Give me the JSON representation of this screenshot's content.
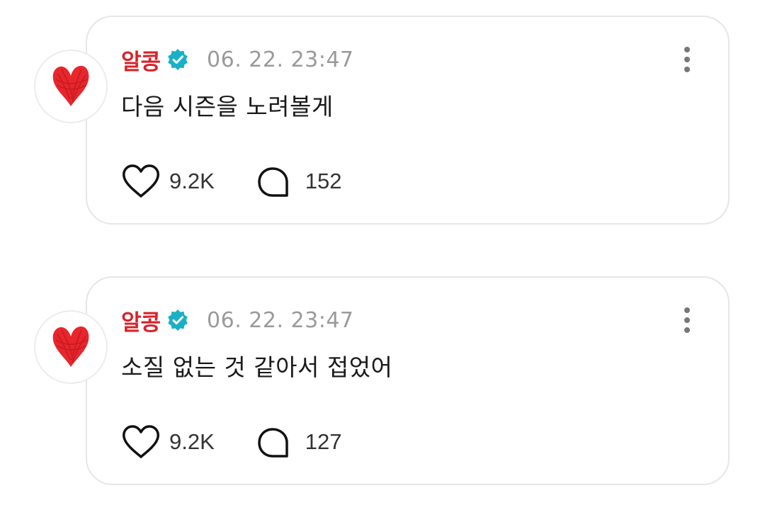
{
  "posts": [
    {
      "author": "알콩",
      "timestamp": "06. 22. 23:47",
      "text": "다음 시즌을 노려볼게",
      "likes": "9.2K",
      "comments": "152"
    },
    {
      "author": "알콩",
      "timestamp": "06. 22. 23:47",
      "text": "소질 없는 것 같아서 접었어",
      "likes": "9.2K",
      "comments": "127"
    }
  ],
  "icons": {
    "avatar": "red-heart-icon",
    "verified": "verified-badge-icon",
    "more": "more-vertical-icon",
    "like": "heart-outline-icon",
    "comment": "comment-bubble-icon"
  },
  "colors": {
    "author": "#d7232b",
    "verified": "#1ab0c8",
    "timestamp": "#9a9a9a",
    "avatar_heart": "#e8262c"
  }
}
